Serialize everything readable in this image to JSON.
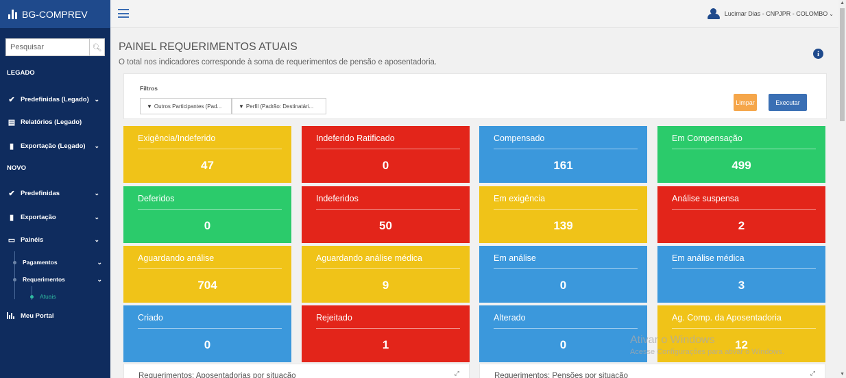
{
  "app": {
    "brand": "BG-COMPREV"
  },
  "search": {
    "placeholder": "Pesquisar"
  },
  "sidebar": {
    "section_legacy": "LEGADO",
    "section_new": "NOVO",
    "items": [
      {
        "label": "Predefinidas (Legado)",
        "icon": "check-icon"
      },
      {
        "label": "Relatórios (Legado)",
        "icon": "document-icon"
      },
      {
        "label": "Exportação (Legado)",
        "icon": "file-icon"
      },
      {
        "label": "Predefinidas",
        "icon": "check-icon"
      },
      {
        "label": "Exportação",
        "icon": "file-icon"
      },
      {
        "label": "Painéis",
        "icon": "monitor-icon"
      },
      {
        "label": "Meu Portal",
        "icon": "bar-chart-icon"
      }
    ],
    "sub_items": [
      {
        "label": "Pagamentos"
      },
      {
        "label": "Requerimentos"
      },
      {
        "label": "Atuais"
      }
    ]
  },
  "topbar": {
    "user": "Lucimar Dias - CNPJPR - COLOMBO"
  },
  "page": {
    "title": "PAINEL REQUERIMENTOS ATUAIS",
    "subtitle": "O total nos indicadores corresponde à soma de requerimentos de pensão e aposentadoria."
  },
  "filters": {
    "label": "Filtros",
    "filter1": "Outros Participantes (Pad...",
    "filter2": "Perfil (Padrão: Destinatári...",
    "clear": "Limpar",
    "run": "Executar"
  },
  "tiles": [
    {
      "label": "Exigência/Indeferido",
      "value": "47",
      "color": "#f0c318"
    },
    {
      "label": "Indeferido Ratificado",
      "value": "0",
      "color": "#e3251a"
    },
    {
      "label": "Compensado",
      "value": "161",
      "color": "#3b98dc"
    },
    {
      "label": "Em Compensação",
      "value": "499",
      "color": "#2bcb6b"
    },
    {
      "label": "Deferidos",
      "value": "0",
      "color": "#2bcb6b"
    },
    {
      "label": "Indeferidos",
      "value": "50",
      "color": "#e3251a"
    },
    {
      "label": "Em exigência",
      "value": "139",
      "color": "#f0c318"
    },
    {
      "label": "Análise suspensa",
      "value": "2",
      "color": "#e3251a"
    },
    {
      "label": "Aguardando análise",
      "value": "704",
      "color": "#f0c318"
    },
    {
      "label": "Aguardando análise médica",
      "value": "9",
      "color": "#f0c318"
    },
    {
      "label": "Em análise",
      "value": "0",
      "color": "#3b98dc"
    },
    {
      "label": "Em análise médica",
      "value": "3",
      "color": "#3b98dc"
    },
    {
      "label": "Criado",
      "value": "0",
      "color": "#3b98dc"
    },
    {
      "label": "Rejeitado",
      "value": "1",
      "color": "#e3251a"
    },
    {
      "label": "Alterado",
      "value": "0",
      "color": "#3b98dc"
    },
    {
      "label": "Ag. Comp. da Aposentadoria",
      "value": "12",
      "color": "#f0c318"
    }
  ],
  "cards": [
    {
      "title": "Requerimentos: Aposentadorias por situação"
    },
    {
      "title": "Requerimentos: Pensões por situação"
    }
  ],
  "watermark": {
    "line1": "Ativar o Windows",
    "line2": "Acesse Configurações para ativar o Windows."
  }
}
